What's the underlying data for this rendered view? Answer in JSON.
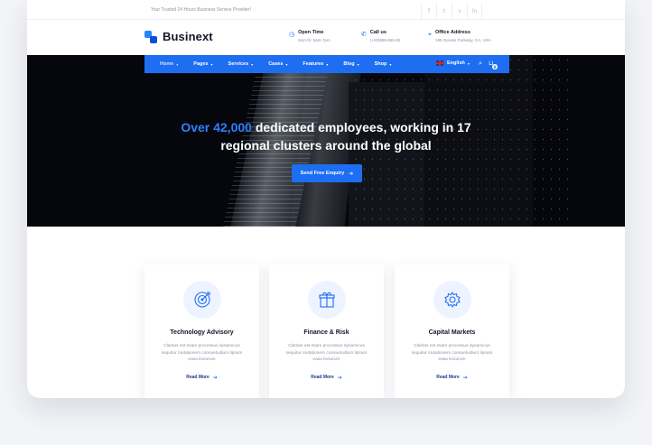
{
  "topbar": {
    "tagline": "Your Trusted 24 Hours Business Service Provider!",
    "socials": [
      {
        "icon": "facebook-icon",
        "glyph": "f"
      },
      {
        "icon": "twitter-icon",
        "glyph": "t"
      },
      {
        "icon": "vimeo-icon",
        "glyph": "v"
      },
      {
        "icon": "linkedin-icon",
        "glyph": "in"
      }
    ]
  },
  "header": {
    "logo_text": "Businext",
    "open_time": {
      "title": "Open Time",
      "value": "Mon-fri: 8am-7pm"
    },
    "call_us": {
      "title": "Call us",
      "value": "(+00)888.666.88"
    },
    "office": {
      "title": "Office Address",
      "value": "185 Donato Parkway, CA, USA"
    }
  },
  "nav": {
    "items": [
      "Home",
      "Pages",
      "Services",
      "Cases",
      "Features",
      "Blog",
      "Shop"
    ],
    "language": "English",
    "cart_count": "0"
  },
  "hero": {
    "highlight": "Over 42,000",
    "title_rest": " dedicated employees, working in 17",
    "title_line2": "regional clusters around the global",
    "button": "Send Free Enquiry"
  },
  "cards": [
    {
      "icon": "target-icon",
      "title": "Technology Advisory",
      "desc": "Claritas est etiam processus dynamicus sequitur mutationem consuetudium lipsum easa lectorum",
      "more": "Read More"
    },
    {
      "icon": "gift-icon",
      "title": "Finance & Risk",
      "desc": "Claritas est etiam processus dynamicus sequitur mutationem consuetudium lipsum easa lectorum",
      "more": "Read More"
    },
    {
      "icon": "gear-icon",
      "title": "Capital Markets",
      "desc": "Claritas est etiam processus dynamicus sequitur mutationem consuetudium lipsum easa lectorum",
      "more": "Read More"
    }
  ],
  "colors": {
    "accent": "#1e6ef2",
    "highlight": "#2f80ff",
    "dark": "#12162a"
  }
}
